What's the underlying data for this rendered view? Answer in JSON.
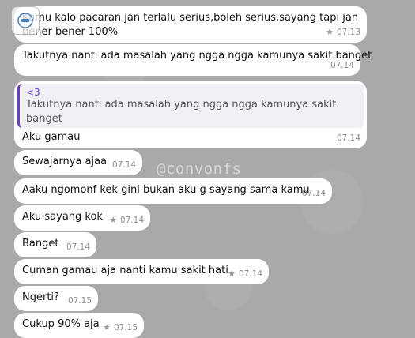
{
  "messages": [
    {
      "text": "Kamu kalo pacaran jan terlalu serius,boleh serius,sayang tapi jan\nbener bener 100%",
      "time": "07.13",
      "starred": true
    },
    {
      "text": "Takutnya nanti ada masalah yang ngga ngga kamunya sakit banget",
      "time": "07.14",
      "starred": false
    },
    {
      "reply_to_sender": "<3",
      "reply_to_text": "Takutnya nanti ada masalah yang ngga ngga kamunya sakit banget",
      "text": "Aku gamau",
      "time": "07.14",
      "starred": false
    },
    {
      "text": "Sewajarnya ajaa",
      "time": "07.14",
      "starred": false
    },
    {
      "text": "Aaku ngomonf kek gini bukan aku g sayang sama kamu",
      "time": "07.14",
      "starred": false
    },
    {
      "text": "Aku sayang kok",
      "time": "07.14",
      "starred": true
    },
    {
      "text": "Banget",
      "time": "07.14",
      "starred": false
    },
    {
      "text": "Cuman gamau aja nanti kamu sakit hati",
      "time": "07.14",
      "starred": true
    },
    {
      "text": "Ngerti?",
      "time": "07.15",
      "starred": false
    },
    {
      "text": "Cukup 90% aja",
      "time": "07.15",
      "starred": true
    }
  ],
  "watermark": "@convonfs",
  "icons": {
    "star": "star-icon",
    "overlay": "app-overlay-icon"
  }
}
